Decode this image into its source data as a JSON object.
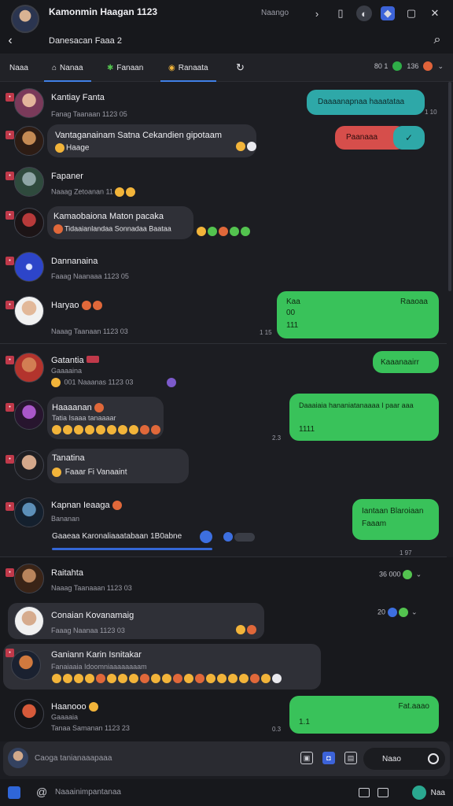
{
  "header": {
    "title": "Kamonmin Haagan 1123",
    "subtitle": "Danesacan Faaa 2",
    "status_label": "Naango"
  },
  "tabs": [
    {
      "label": "Naaa"
    },
    {
      "label": "Nanaa"
    },
    {
      "label": "Fanaan"
    },
    {
      "label": "Ranaata"
    }
  ],
  "tab_counts": {
    "first": "80 1",
    "second": "136"
  },
  "rows": [
    {
      "name": "Kantiay Fanta",
      "meta": "Fanag   Taanaan   1123 05",
      "message": ""
    },
    {
      "name": "Vantaganainam Satna Cekandien gipotaam",
      "meta": "",
      "message": "Haage"
    },
    {
      "name": "Fapaner",
      "meta": "Naaag   Zetoanan   11",
      "message": ""
    },
    {
      "name": "Kamaobaiona Maton pacaka",
      "meta": "",
      "message": "Tidaaianlandaa Sonnadaa Baataa"
    },
    {
      "name": "Dannanaina",
      "meta": "Faaag   Naanaaa   1123 05",
      "message": ""
    },
    {
      "name": "Haryao",
      "meta": "Naaag   Taanaan   1123 03",
      "message": ""
    },
    {
      "name": "Gatantia",
      "meta": "Gaaaaina",
      "message": "001   Naaanas   1123 03"
    },
    {
      "name": "Haaaanan",
      "meta": "Tatia Isaaa tanaaaar",
      "message": "Tatia Isaaa tanaaaar"
    },
    {
      "name": "Tanatina",
      "meta": "",
      "message": "Faaar   Fi Vanaaint"
    },
    {
      "name": "Kapnan Ieaaga",
      "meta": "Bananan",
      "message": "Gaaeaa Karonaliaaatabaan 1B0abne"
    },
    {
      "name": "Raitahta",
      "meta": "Naaag   Taanaaan   1123 03",
      "message": ""
    },
    {
      "name": "Conaian Kovanamaig",
      "meta": "Faaag   Naanaa   1123 03",
      "message": ""
    },
    {
      "name": "Ganiann Karin Isnitakar",
      "meta": "",
      "message": "Fanaiaaia Idoomniaaaaaaaam"
    },
    {
      "name": "Haanooo",
      "meta": "Gaaaaia",
      "message": "Tanaa   Samanan   1123 23"
    }
  ],
  "right_bubbles": [
    {
      "text": "Daaaanapnaa haaatataa",
      "time": "1 10"
    },
    {
      "text": "Paanaaa",
      "time": ""
    },
    {
      "text": "Kaa",
      "line2": "00",
      "line3": "111",
      "extra": "Raaoaa",
      "time": "1 15"
    },
    {
      "text": "Kaaanaairr",
      "time": ""
    },
    {
      "text": "Daaaiaia hananiatanaaaa I paar aaa",
      "line2": "1111",
      "time": "2.3"
    },
    {
      "text": "Iantaan Blaroiaan",
      "line2": "Faaam",
      "time": "1 97"
    },
    {
      "text": "Fat.aaao",
      "line2": "1.1",
      "time": "0.3"
    }
  ],
  "section_counts": {
    "first": "36 000",
    "second": "20"
  },
  "composer": {
    "placeholder": "Caoga tanianaaapaaa",
    "send_label": "Naao"
  },
  "bottombar": {
    "label": "Naaainimpantanaa",
    "status": "Naa"
  }
}
